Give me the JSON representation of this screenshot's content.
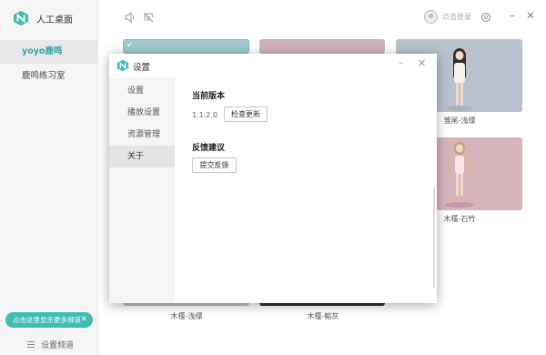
{
  "app": {
    "name": "人工桌面"
  },
  "sidebar": {
    "items": [
      {
        "label": "yoyo鹿鸣",
        "active": true
      },
      {
        "label": "鹿鸣练习室",
        "active": false
      }
    ],
    "channel_tip": "点击这里显示更多频道",
    "channel_settings": "设置频道"
  },
  "topbar": {
    "login": "点击登录"
  },
  "cards": [
    {
      "caption": ""
    },
    {
      "caption": ""
    },
    {
      "caption": "雏尾-浅缥"
    },
    {
      "caption": ""
    },
    {
      "caption": ""
    },
    {
      "caption": "木槿-石竹"
    },
    {
      "caption": "木槿-浅缥"
    },
    {
      "caption": "木槿-鲸灰"
    }
  ],
  "dialog": {
    "title": "设置",
    "nav": [
      {
        "label": "设置",
        "active": false
      },
      {
        "label": "播放设置",
        "active": false
      },
      {
        "label": "资源管理",
        "active": false
      },
      {
        "label": "关于",
        "active": true
      }
    ],
    "version_title": "当前版本",
    "version": "1.1.2.0",
    "check_update": "检查更新",
    "feedback_title": "反馈建议",
    "submit_feedback": "提交反馈"
  },
  "colors": {
    "accent": "#2aa7a7",
    "tip_bg": "#3dbdb4",
    "card_teal": "#9fc9cc",
    "card_pink": "#cfb2b8",
    "card_blue": "#b9c2cc",
    "card_rose": "#d7b3bc",
    "card_dark": "#2e3138"
  }
}
